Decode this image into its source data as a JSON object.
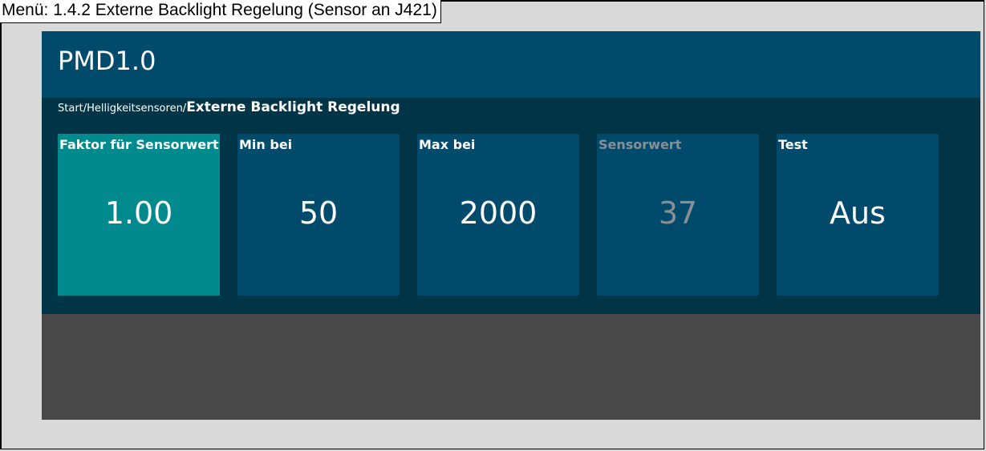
{
  "menu": {
    "title": "Menü: 1.4.2 Externe Backlight Regelung (Sensor an J421)"
  },
  "app": {
    "title": "PMD1.0"
  },
  "breadcrumb": {
    "path": "Start/Helligkeitsensoren/",
    "current": "Externe Backlight Regelung"
  },
  "tiles": [
    {
      "label": "Faktor für Sensorwert",
      "value": "1.00",
      "state": "selected"
    },
    {
      "label": "Min bei",
      "value": "50",
      "state": "normal"
    },
    {
      "label": "Max bei",
      "value": "2000",
      "state": "normal"
    },
    {
      "label": "Sensorwert",
      "value": "37",
      "state": "disabled"
    },
    {
      "label": "Test",
      "value": "Aus",
      "state": "normal"
    }
  ],
  "colors": {
    "header": "#004a6c",
    "content": "#003548",
    "tile": "#004a6c",
    "tile_selected": "#008a8e",
    "tile_disabled_text": "#8a8f93",
    "screen_bottom": "#484848"
  }
}
